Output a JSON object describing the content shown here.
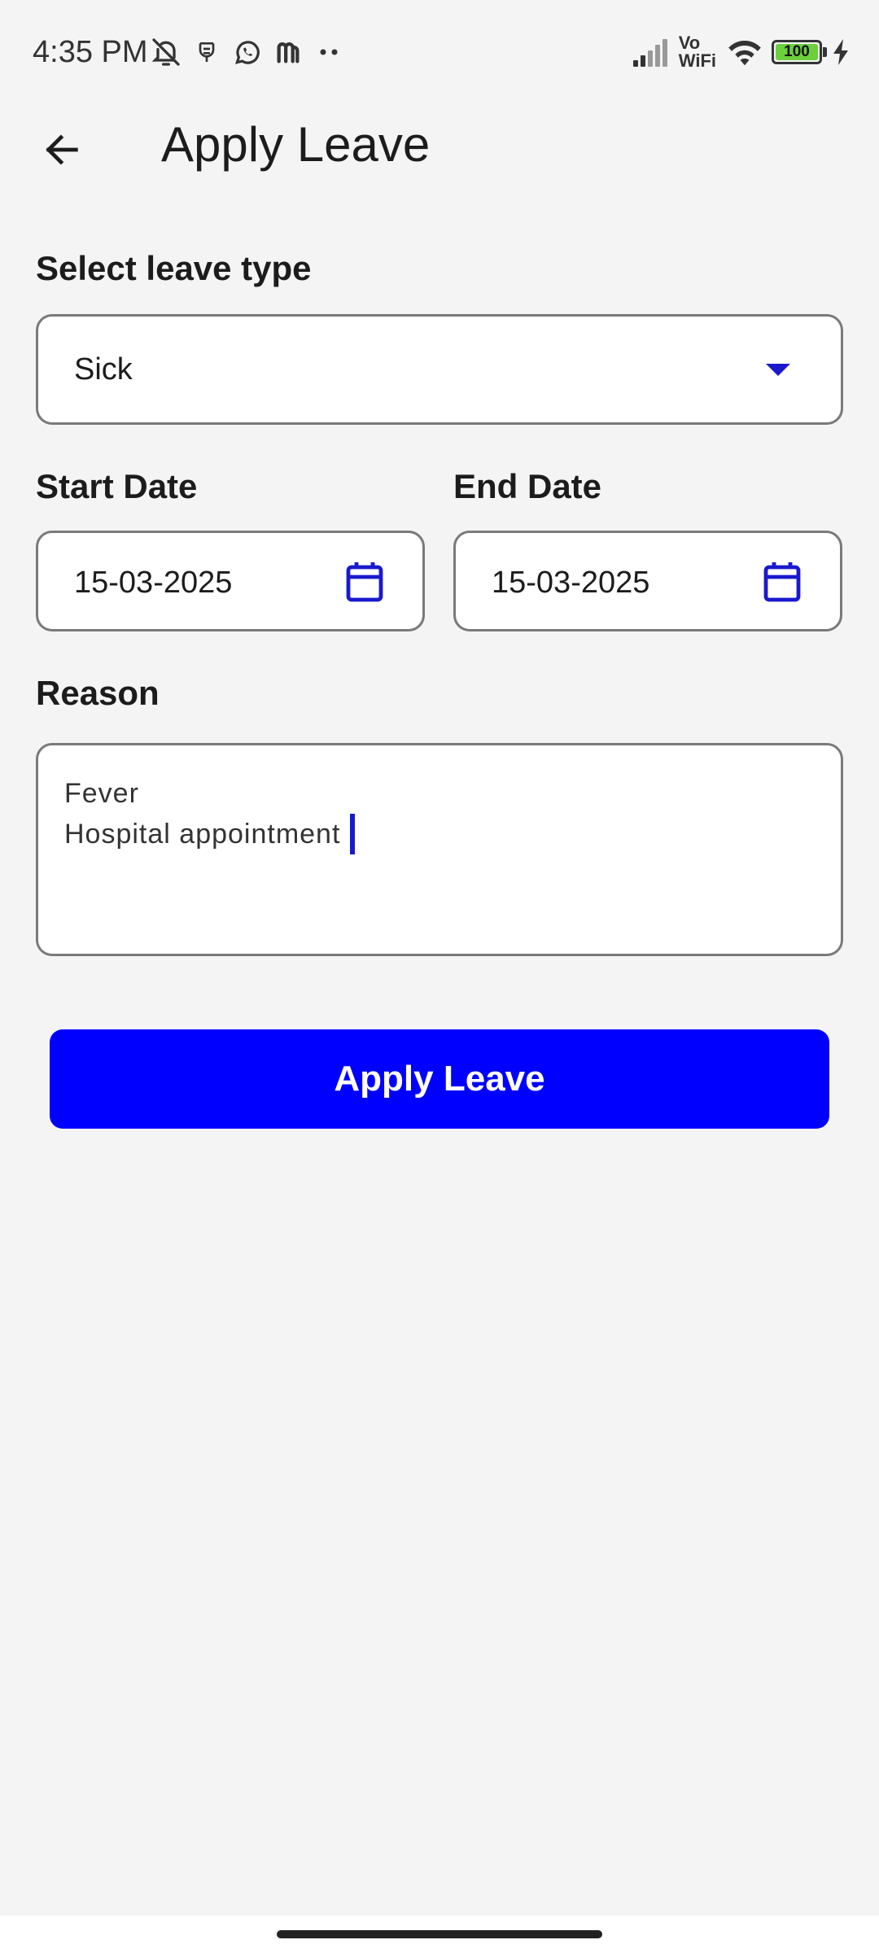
{
  "status_bar": {
    "time": "4:35 PM",
    "left_icons": [
      "bell-off-icon",
      "notification-app-icon",
      "whatsapp-icon",
      "m-app-icon",
      "more-dots-icon"
    ],
    "vo_label": "Vo",
    "wifi_label": "WiFi",
    "battery_level": "100",
    "battery_fraction": 1.0,
    "charging": true
  },
  "app_bar": {
    "back_icon": "arrow-left-icon",
    "title": "Apply Leave"
  },
  "form": {
    "leave_type": {
      "label": "Select leave type",
      "value": "Sick",
      "icon": "dropdown-arrow-icon"
    },
    "start_date": {
      "label": "Start Date",
      "value": "15-03-2025",
      "icon": "calendar-icon"
    },
    "end_date": {
      "label": "End Date",
      "value": "15-03-2025",
      "icon": "calendar-icon"
    },
    "reason": {
      "label": "Reason",
      "lines": [
        "Fever",
        "Hospital appointment"
      ]
    },
    "submit_label": "Apply Leave"
  },
  "colors": {
    "accent": "#0000ff",
    "icon_blue": "#1a1acc",
    "background": "#f4f4f4",
    "field_border": "#7a7a7a",
    "battery_fill": "#6ccf3c"
  }
}
